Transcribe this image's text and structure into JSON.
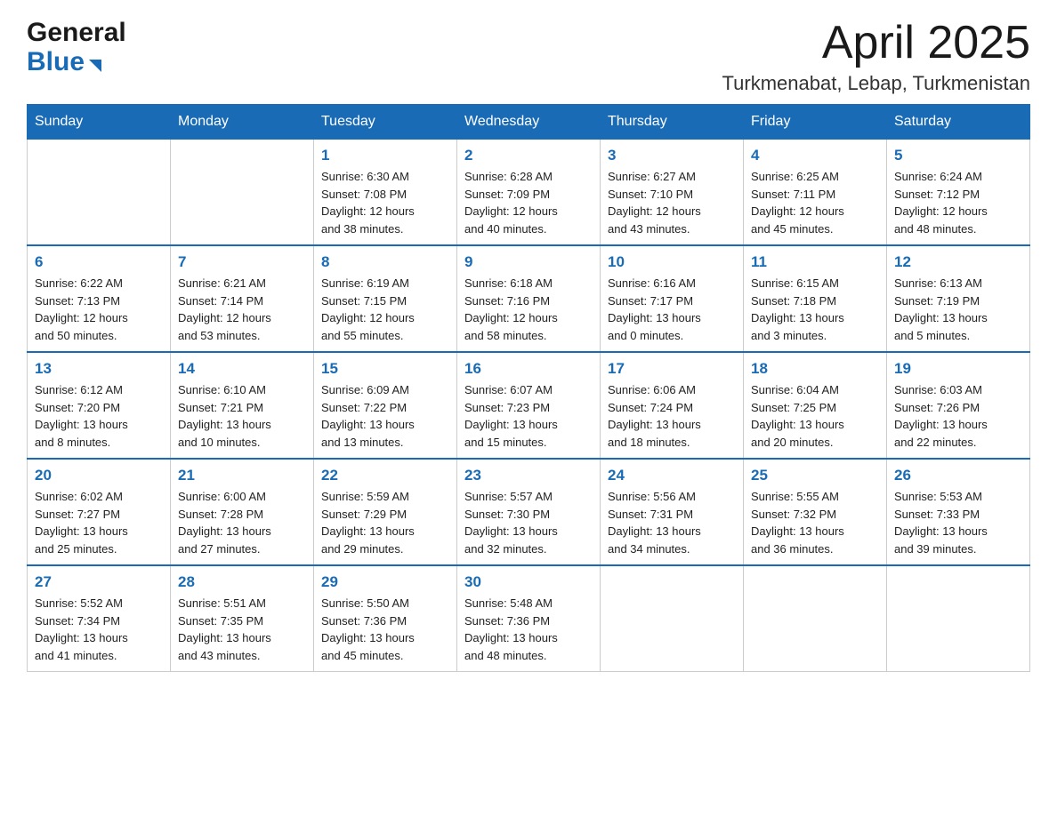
{
  "logo": {
    "general": "General",
    "blue": "Blue"
  },
  "header": {
    "title": "April 2025",
    "subtitle": "Turkmenabat, Lebap, Turkmenistan"
  },
  "weekdays": [
    "Sunday",
    "Monday",
    "Tuesday",
    "Wednesday",
    "Thursday",
    "Friday",
    "Saturday"
  ],
  "weeks": [
    [
      {
        "num": "",
        "info": ""
      },
      {
        "num": "",
        "info": ""
      },
      {
        "num": "1",
        "info": "Sunrise: 6:30 AM\nSunset: 7:08 PM\nDaylight: 12 hours\nand 38 minutes."
      },
      {
        "num": "2",
        "info": "Sunrise: 6:28 AM\nSunset: 7:09 PM\nDaylight: 12 hours\nand 40 minutes."
      },
      {
        "num": "3",
        "info": "Sunrise: 6:27 AM\nSunset: 7:10 PM\nDaylight: 12 hours\nand 43 minutes."
      },
      {
        "num": "4",
        "info": "Sunrise: 6:25 AM\nSunset: 7:11 PM\nDaylight: 12 hours\nand 45 minutes."
      },
      {
        "num": "5",
        "info": "Sunrise: 6:24 AM\nSunset: 7:12 PM\nDaylight: 12 hours\nand 48 minutes."
      }
    ],
    [
      {
        "num": "6",
        "info": "Sunrise: 6:22 AM\nSunset: 7:13 PM\nDaylight: 12 hours\nand 50 minutes."
      },
      {
        "num": "7",
        "info": "Sunrise: 6:21 AM\nSunset: 7:14 PM\nDaylight: 12 hours\nand 53 minutes."
      },
      {
        "num": "8",
        "info": "Sunrise: 6:19 AM\nSunset: 7:15 PM\nDaylight: 12 hours\nand 55 minutes."
      },
      {
        "num": "9",
        "info": "Sunrise: 6:18 AM\nSunset: 7:16 PM\nDaylight: 12 hours\nand 58 minutes."
      },
      {
        "num": "10",
        "info": "Sunrise: 6:16 AM\nSunset: 7:17 PM\nDaylight: 13 hours\nand 0 minutes."
      },
      {
        "num": "11",
        "info": "Sunrise: 6:15 AM\nSunset: 7:18 PM\nDaylight: 13 hours\nand 3 minutes."
      },
      {
        "num": "12",
        "info": "Sunrise: 6:13 AM\nSunset: 7:19 PM\nDaylight: 13 hours\nand 5 minutes."
      }
    ],
    [
      {
        "num": "13",
        "info": "Sunrise: 6:12 AM\nSunset: 7:20 PM\nDaylight: 13 hours\nand 8 minutes."
      },
      {
        "num": "14",
        "info": "Sunrise: 6:10 AM\nSunset: 7:21 PM\nDaylight: 13 hours\nand 10 minutes."
      },
      {
        "num": "15",
        "info": "Sunrise: 6:09 AM\nSunset: 7:22 PM\nDaylight: 13 hours\nand 13 minutes."
      },
      {
        "num": "16",
        "info": "Sunrise: 6:07 AM\nSunset: 7:23 PM\nDaylight: 13 hours\nand 15 minutes."
      },
      {
        "num": "17",
        "info": "Sunrise: 6:06 AM\nSunset: 7:24 PM\nDaylight: 13 hours\nand 18 minutes."
      },
      {
        "num": "18",
        "info": "Sunrise: 6:04 AM\nSunset: 7:25 PM\nDaylight: 13 hours\nand 20 minutes."
      },
      {
        "num": "19",
        "info": "Sunrise: 6:03 AM\nSunset: 7:26 PM\nDaylight: 13 hours\nand 22 minutes."
      }
    ],
    [
      {
        "num": "20",
        "info": "Sunrise: 6:02 AM\nSunset: 7:27 PM\nDaylight: 13 hours\nand 25 minutes."
      },
      {
        "num": "21",
        "info": "Sunrise: 6:00 AM\nSunset: 7:28 PM\nDaylight: 13 hours\nand 27 minutes."
      },
      {
        "num": "22",
        "info": "Sunrise: 5:59 AM\nSunset: 7:29 PM\nDaylight: 13 hours\nand 29 minutes."
      },
      {
        "num": "23",
        "info": "Sunrise: 5:57 AM\nSunset: 7:30 PM\nDaylight: 13 hours\nand 32 minutes."
      },
      {
        "num": "24",
        "info": "Sunrise: 5:56 AM\nSunset: 7:31 PM\nDaylight: 13 hours\nand 34 minutes."
      },
      {
        "num": "25",
        "info": "Sunrise: 5:55 AM\nSunset: 7:32 PM\nDaylight: 13 hours\nand 36 minutes."
      },
      {
        "num": "26",
        "info": "Sunrise: 5:53 AM\nSunset: 7:33 PM\nDaylight: 13 hours\nand 39 minutes."
      }
    ],
    [
      {
        "num": "27",
        "info": "Sunrise: 5:52 AM\nSunset: 7:34 PM\nDaylight: 13 hours\nand 41 minutes."
      },
      {
        "num": "28",
        "info": "Sunrise: 5:51 AM\nSunset: 7:35 PM\nDaylight: 13 hours\nand 43 minutes."
      },
      {
        "num": "29",
        "info": "Sunrise: 5:50 AM\nSunset: 7:36 PM\nDaylight: 13 hours\nand 45 minutes."
      },
      {
        "num": "30",
        "info": "Sunrise: 5:48 AM\nSunset: 7:36 PM\nDaylight: 13 hours\nand 48 minutes."
      },
      {
        "num": "",
        "info": ""
      },
      {
        "num": "",
        "info": ""
      },
      {
        "num": "",
        "info": ""
      }
    ]
  ]
}
